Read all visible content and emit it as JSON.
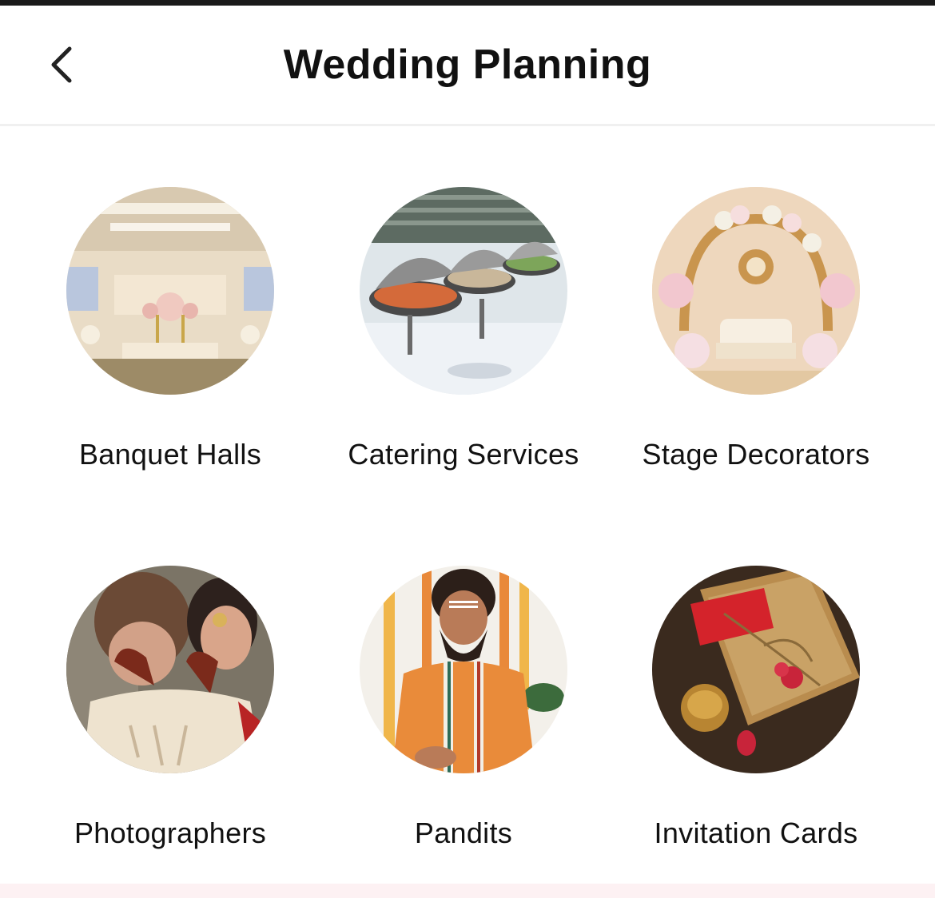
{
  "header": {
    "title": "Wedding Planning",
    "back_icon": "chevron-left-icon"
  },
  "categories": [
    {
      "label": "Banquet Halls",
      "image": "banquet-hall-photo"
    },
    {
      "label": "Catering Services",
      "image": "catering-buffet-photo"
    },
    {
      "label": "Stage Decorators",
      "image": "floral-stage-photo"
    },
    {
      "label": "Photographers",
      "image": "wedding-couple-photo"
    },
    {
      "label": "Pandits",
      "image": "pandit-priest-photo"
    },
    {
      "label": "Invitation Cards",
      "image": "invitation-card-photo"
    }
  ]
}
